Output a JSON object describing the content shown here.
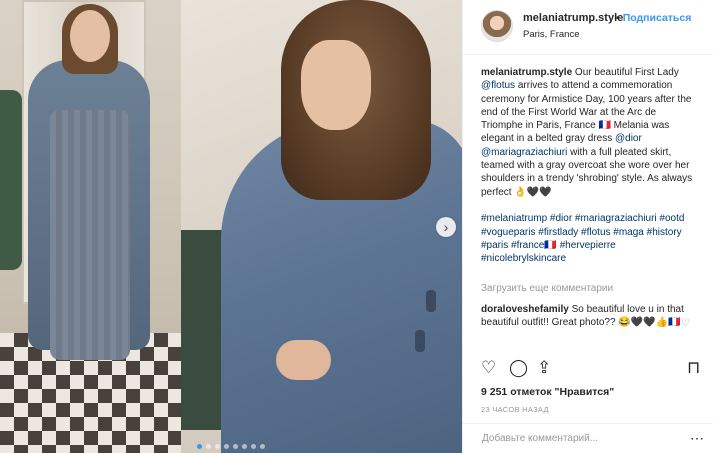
{
  "post": {
    "username": "melaniatrump.style",
    "follow_label": "Подписаться",
    "follow_separator": "•",
    "location": "Paris, France"
  },
  "caption": {
    "username": "melaniatrump.style",
    "part1": " Our beautiful First Lady ",
    "mention1": "@flotus",
    "part2": " arrives to attend a commemoration ceremony for Armistice Day, 100 years after the end of the First World War at the Arc de Triomphe in Paris, France 🇫🇷 Melania was elegant in a belted gray dress ",
    "mention2": "@dior",
    "mention3": "@mariagraziachiuri",
    "part3": " with a full pleated skirt, teamed with a gray overcoat she wore over her shoulders in a trendy 'shrobing' style. As always perfect 👌🖤🖤",
    "hashtags": "#melaniatrump #dior #mariagraziachiuri #ootd #vogueparis #firstlady #flotus #maga #history #paris #france🇫🇷 #hervepierre #nicolebrylskincare"
  },
  "comments": {
    "load_more": "Загрузить еще комментарии",
    "items": [
      {
        "username": "doraloveshefamily",
        "text": " So beautiful love u in that beautiful outfit!! Great photo?? 😂🖤🖤👍🇫🇷"
      }
    ]
  },
  "stats": {
    "likes": "9 251 отметок \"Нравится\"",
    "time": "23 ЧАСОВ НАЗАД"
  },
  "add_comment": {
    "placeholder": "Добавьте комментарий..."
  },
  "icons": {
    "heart": "heart-icon",
    "comment": "comment-icon",
    "share": "share-icon",
    "bookmark": "bookmark-icon",
    "next": "chevron-right-icon",
    "more": "more-icon"
  },
  "carousel": {
    "slides": 8,
    "active_index": 0
  },
  "colors": {
    "link": "#003569",
    "follow": "#3897f0",
    "muted": "#999999"
  }
}
